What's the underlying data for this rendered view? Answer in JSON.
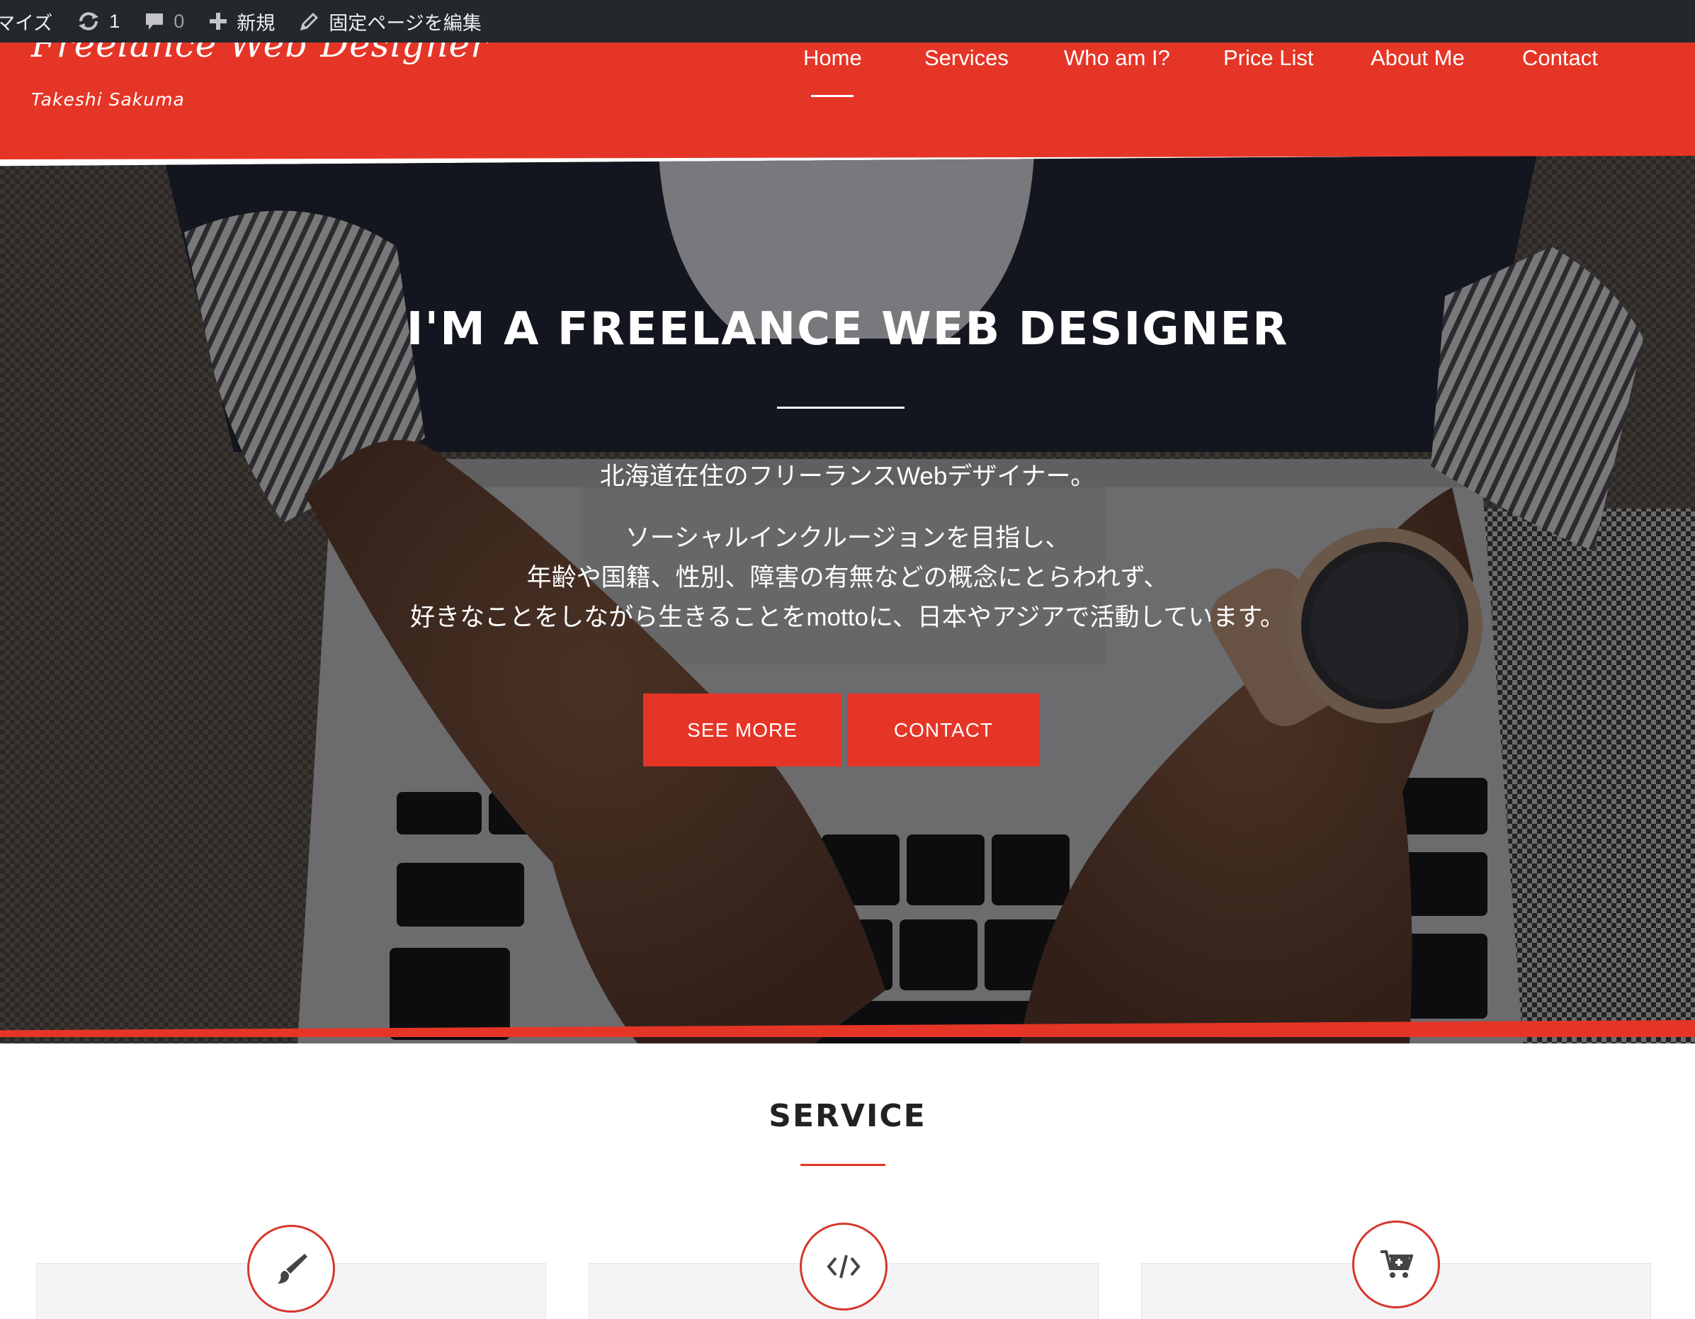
{
  "admin_bar": {
    "customize_label": "マイズ",
    "updates_count": "1",
    "comments_count": "0",
    "new_label": "新規",
    "edit_page_label": "固定ページを編集",
    "icons": [
      "refresh-icon",
      "comment-icon",
      "plus-icon",
      "pencil-icon"
    ]
  },
  "header": {
    "site_title": "Freelance Web Designer",
    "tagline": "Takeshi Sakuma",
    "background_color": "#e53527",
    "nav": [
      {
        "label": "Home",
        "active": true
      },
      {
        "label": "Services"
      },
      {
        "label": "Who am I?"
      },
      {
        "label": "Price List"
      },
      {
        "label": "About Me"
      },
      {
        "label": "Contact"
      }
    ]
  },
  "hero": {
    "title": "I'M A FREELANCE WEB DESIGNER",
    "lead": "北海道在住のフリーランスWebデザイナー。",
    "body_lines": [
      "ソーシャルインクルージョンを目指し、",
      "年齢や国籍、性別、障害の有無などの概念にとらわれず、",
      "好きなことをしながら生きることをmottoに、日本やアジアで活動しています。"
    ],
    "buttons": {
      "see_more": "SEE MORE",
      "contact": "CONTACT"
    }
  },
  "service": {
    "title": "SERVICE",
    "cards": [
      {
        "icon": "paintbrush-icon"
      },
      {
        "icon": "code-icon"
      },
      {
        "icon": "cart-icon"
      }
    ]
  },
  "colors": {
    "accent": "#e53527",
    "admin_bar": "#23282d",
    "text_dark": "#222222"
  }
}
